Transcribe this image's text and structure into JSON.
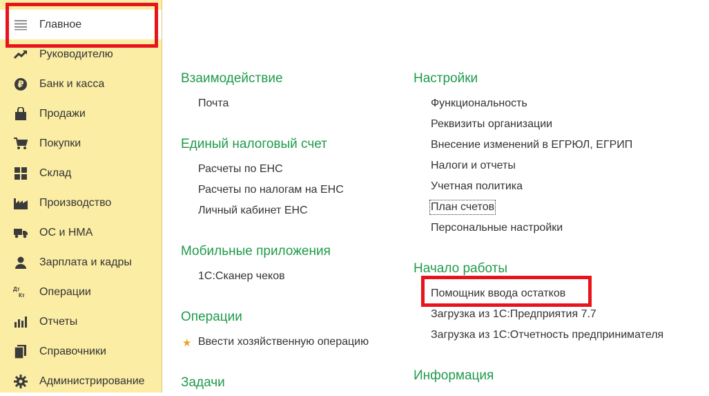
{
  "colors": {
    "sidebar_bg": "#fbeda4",
    "section_title": "#1f9a4b",
    "highlight": "#e8141b",
    "star": "#f0a020"
  },
  "sidebar": {
    "items": [
      {
        "label": "Главное",
        "icon": "menu-lines-icon",
        "active": true
      },
      {
        "label": "Руководителю",
        "icon": "trend-up-icon"
      },
      {
        "label": "Банк и касса",
        "icon": "ruble-coin-icon"
      },
      {
        "label": "Продажи",
        "icon": "shopping-bag-icon"
      },
      {
        "label": "Покупки",
        "icon": "cart-icon"
      },
      {
        "label": "Склад",
        "icon": "warehouse-grid-icon"
      },
      {
        "label": "Производство",
        "icon": "factory-icon"
      },
      {
        "label": "ОС и НМА",
        "icon": "truck-icon"
      },
      {
        "label": "Зарплата и кадры",
        "icon": "person-icon"
      },
      {
        "label": "Операции",
        "icon": "debit-credit-icon",
        "icon_text_top": "Дт",
        "icon_text_bottom": "Кт"
      },
      {
        "label": "Отчеты",
        "icon": "bar-chart-icon"
      },
      {
        "label": "Справочники",
        "icon": "books-icon"
      },
      {
        "label": "Администрирование",
        "icon": "gear-icon"
      }
    ]
  },
  "main": {
    "left_column": [
      {
        "title": "Взаимодействие",
        "links": [
          "Почта"
        ]
      },
      {
        "title": "Единый налоговый счет",
        "links": [
          "Расчеты по ЕНС",
          "Расчеты по налогам на ЕНС",
          "Личный кабинет ЕНС"
        ]
      },
      {
        "title": "Мобильные приложения",
        "links": [
          "1С:Сканер чеков"
        ]
      },
      {
        "title": "Операции",
        "links": [
          "Ввести хозяйственную операцию"
        ],
        "starred_link": 0
      },
      {
        "title": "Задачи",
        "links": []
      }
    ],
    "right_column": [
      {
        "title": "Настройки",
        "links": [
          "Функциональность",
          "Реквизиты организации",
          "Внесение изменений в ЕГРЮЛ, ЕГРИП",
          "Налоги и отчеты",
          "Учетная политика",
          "План счетов",
          "Персональные настройки"
        ],
        "focused_link": 5
      },
      {
        "title": "Начало работы",
        "links": [
          "Помощник ввода остатков",
          "Загрузка из 1С:Предприятия 7.7",
          "Загрузка из 1С:Отчетность предпринимателя"
        ],
        "highlighted_link": 0
      },
      {
        "title": "Информация",
        "links": []
      }
    ]
  }
}
